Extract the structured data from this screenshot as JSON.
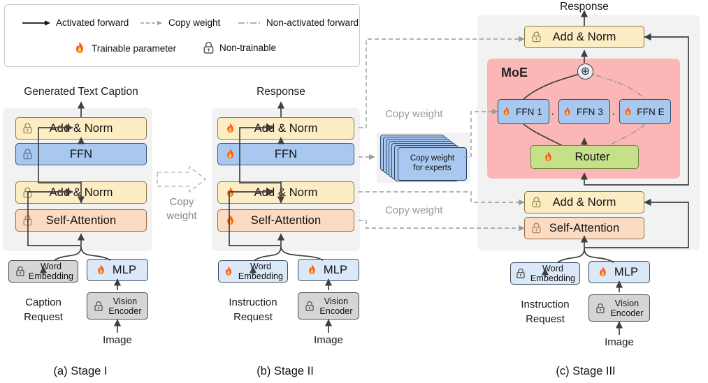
{
  "legend": {
    "items": [
      {
        "id": "activated-forward",
        "label": "Activated forward",
        "icon": "solid-arrow"
      },
      {
        "id": "copy-weight",
        "label": "Copy weight",
        "icon": "dashed-arrow"
      },
      {
        "id": "non-activated-forward",
        "label": "Non-activated forward",
        "icon": "dash-dot-line"
      },
      {
        "id": "trainable-parameter",
        "label": "Trainable parameter",
        "icon": "fire-icon"
      },
      {
        "id": "non-trainable",
        "label": "Non-trainable",
        "icon": "lock-icon"
      }
    ]
  },
  "stage1": {
    "caption": "(a) Stage I",
    "output_label": "Generated Text Caption",
    "blocks": [
      {
        "id": "add-norm-top",
        "label": "Add & Norm",
        "state": "locked",
        "color": "yellow"
      },
      {
        "id": "ffn",
        "label": "FFN",
        "state": "locked",
        "color": "blue"
      },
      {
        "id": "add-norm-bottom",
        "label": "Add & Norm",
        "state": "locked",
        "color": "yellow"
      },
      {
        "id": "self-attention",
        "label": "Self-Attention",
        "state": "locked",
        "color": "orange"
      }
    ],
    "word_embedding": {
      "line1": "Word",
      "line2": "Embedding",
      "state": "locked",
      "color": "gray"
    },
    "mlp": {
      "label": "MLP",
      "state": "trainable",
      "color": "lblue"
    },
    "vision_encoder": {
      "line1": "Vision",
      "line2": "Encoder",
      "state": "locked",
      "color": "gray"
    },
    "text_input_label": "Caption\nRequest",
    "text_input_line1": "Caption",
    "text_input_line2": "Request",
    "image_label": "Image"
  },
  "stage2": {
    "caption": "(b) Stage II",
    "output_label": "Response",
    "blocks": [
      {
        "id": "add-norm-top",
        "label": "Add & Norm",
        "state": "trainable",
        "color": "yellow"
      },
      {
        "id": "ffn",
        "label": "FFN",
        "state": "trainable",
        "color": "blue"
      },
      {
        "id": "add-norm-bottom",
        "label": "Add & Norm",
        "state": "trainable",
        "color": "yellow"
      },
      {
        "id": "self-attention",
        "label": "Self-Attention",
        "state": "trainable",
        "color": "orange"
      }
    ],
    "word_embedding": {
      "line1": "Word",
      "line2": "Embedding",
      "state": "trainable",
      "color": "lblue"
    },
    "mlp": {
      "label": "MLP",
      "state": "trainable",
      "color": "lblue"
    },
    "vision_encoder": {
      "line1": "Vision",
      "line2": "Encoder",
      "state": "locked",
      "color": "gray"
    },
    "text_input_line1": "Instruction",
    "text_input_line2": "Request",
    "image_label": "Image"
  },
  "stage3": {
    "caption": "(c) Stage III",
    "output_label": "Response",
    "moe_label": "MoE",
    "blocks": [
      {
        "id": "add-norm-top",
        "label": "Add & Norm",
        "state": "locked",
        "color": "yellow"
      },
      {
        "id": "add-norm-bottom",
        "label": "Add & Norm",
        "state": "locked",
        "color": "yellow"
      },
      {
        "id": "self-attention",
        "label": "Self-Attention",
        "state": "locked",
        "color": "orange"
      }
    ],
    "experts": [
      {
        "id": "ffn-1",
        "label": "FFN 1",
        "state": "trainable"
      },
      {
        "id": "ffn-3",
        "label": "FFN 3",
        "state": "trainable"
      },
      {
        "id": "ffn-e",
        "label": "FFN E",
        "state": "trainable"
      }
    ],
    "ellipsis": "· · ·",
    "router": {
      "label": "Router",
      "state": "trainable",
      "color": "green"
    },
    "sum_symbol": "⊕",
    "word_embedding": {
      "line1": "Word",
      "line2": "Embedding",
      "state": "locked",
      "color": "lblue"
    },
    "mlp": {
      "label": "MLP",
      "state": "trainable",
      "color": "lblue"
    },
    "vision_encoder": {
      "line1": "Vision",
      "line2": "Encoder",
      "state": "locked",
      "color": "gray"
    },
    "text_input_line1": "Instruction",
    "text_input_line2": "Request",
    "image_label": "Image"
  },
  "transfer": {
    "stage1_to_2_label_line1": "Copy",
    "stage1_to_2_label_line2": "weight",
    "copy_weight_top": "Copy weight",
    "copy_weight_bottom": "Copy weight",
    "experts_box_line1": "Copy weight",
    "experts_box_line2": "for experts"
  },
  "colors": {
    "yellow": "#fdedc4",
    "blue": "#a8c8ef",
    "orange": "#fbdcc3",
    "light_blue": "#dbe8f7",
    "gray": "#d5d5d5",
    "green": "#c6e08a",
    "moe_pink": "#fbb6b6",
    "panel_gray": "#f2f2f2",
    "dashed_gray": "#9a9a9a",
    "arrow_dark": "#4a4a4a"
  }
}
